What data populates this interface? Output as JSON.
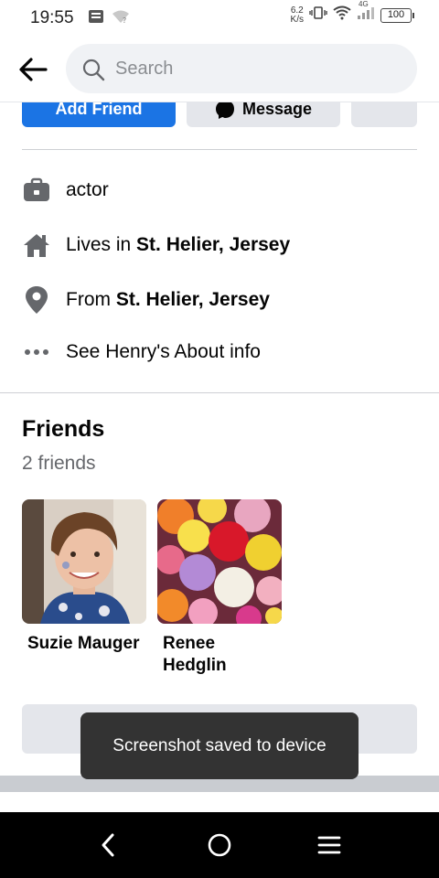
{
  "status": {
    "time": "19:55",
    "speed_top": "6.2",
    "speed_bottom": "K/s",
    "network": "4G",
    "battery": "100"
  },
  "header": {
    "search_placeholder": "Search"
  },
  "actions": {
    "add_friend": "Add Friend",
    "message": "Message"
  },
  "details": {
    "work": "actor",
    "lives_prefix": "Lives in ",
    "lives_place": "St. Helier, Jersey",
    "from_prefix": "From ",
    "from_place": "St. Helier, Jersey",
    "about": "See Henry's About info"
  },
  "friends": {
    "title": "Friends",
    "count": "2 friends",
    "items": [
      {
        "name": "Suzie Mauger"
      },
      {
        "name": "Renee Hedglin"
      }
    ]
  },
  "toast": "Screenshot saved to device",
  "colors": {
    "brand_blue": "#1b74e4",
    "icon_gray": "#65676b",
    "secondary_button": "#e4e6eb",
    "toast_bg": "#333333"
  }
}
